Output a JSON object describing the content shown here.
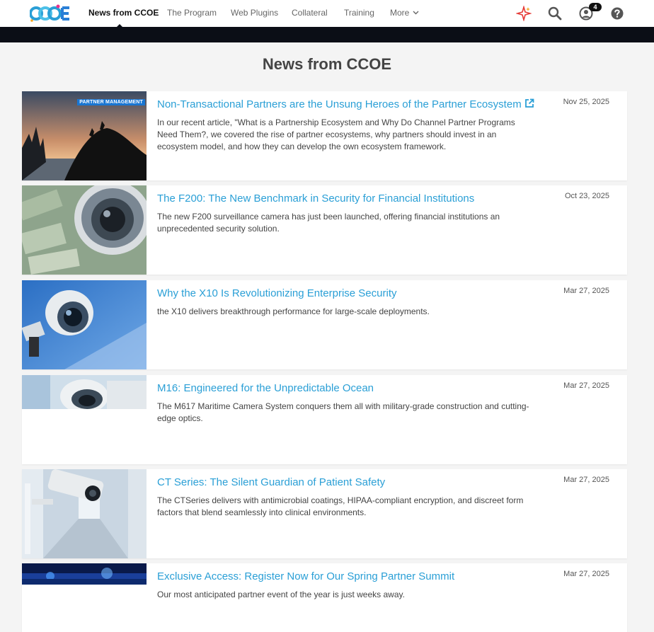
{
  "nav": {
    "logo_alt": "CCOE",
    "items": [
      {
        "label": "News from CCOE",
        "active": true
      },
      {
        "label": "The Program"
      },
      {
        "label": "Web Plugins"
      },
      {
        "label": "Collateral"
      },
      {
        "label": "Training"
      },
      {
        "label": "More"
      }
    ],
    "notification_count": "4",
    "icons": [
      "sparkle-icon",
      "search-icon",
      "user-icon",
      "help-icon"
    ]
  },
  "page": {
    "title": "News from CCOE"
  },
  "articles": [
    {
      "title": "Non-Transactional Partners are the Unsung Heroes of the Partner Ecosystem",
      "external": true,
      "tag": "PARTNER MANAGEMENT",
      "desc": "In our recent article, \"What is a Partnership Ecosystem and Why Do Channel Partner Programs Need Them?, we covered the rise of partner ecosystems, why partners should invest in an ecosystem model, and how they can develop the own ecosystem framework.",
      "date": "Nov 25, 2025"
    },
    {
      "title": "The F200: The New Benchmark in Security for Financial Institutions",
      "desc": "The new F200 surveillance camera has just been launched, offering financial institutions an unprecedented security solution.",
      "date": "Oct 23, 2025"
    },
    {
      "title": "Why the X10 Is Revolutionizing Enterprise Security",
      "desc": "the X10 delivers breakthrough performance for large-scale deployments.",
      "date": "Mar 27, 2025"
    },
    {
      "title": "M16: Engineered for the Unpredictable Ocean",
      "desc": "The M617 Maritime Camera System conquers them all with military-grade construction and cutting-edge optics.",
      "date": "Mar 27, 2025"
    },
    {
      "title": "CT Series: The Silent Guardian of Patient Safety",
      "desc": "The CTSeries delivers with antimicrobial coatings, HIPAA-compliant encryption, and discreet form factors that blend seamlessly into clinical environments.",
      "date": "Mar 27, 2025"
    },
    {
      "title": "Exclusive Access: Register Now for Our Spring Partner Summit",
      "desc": "Our most anticipated partner event of the year is just weeks away.",
      "date": "Mar 27, 2025"
    }
  ]
}
